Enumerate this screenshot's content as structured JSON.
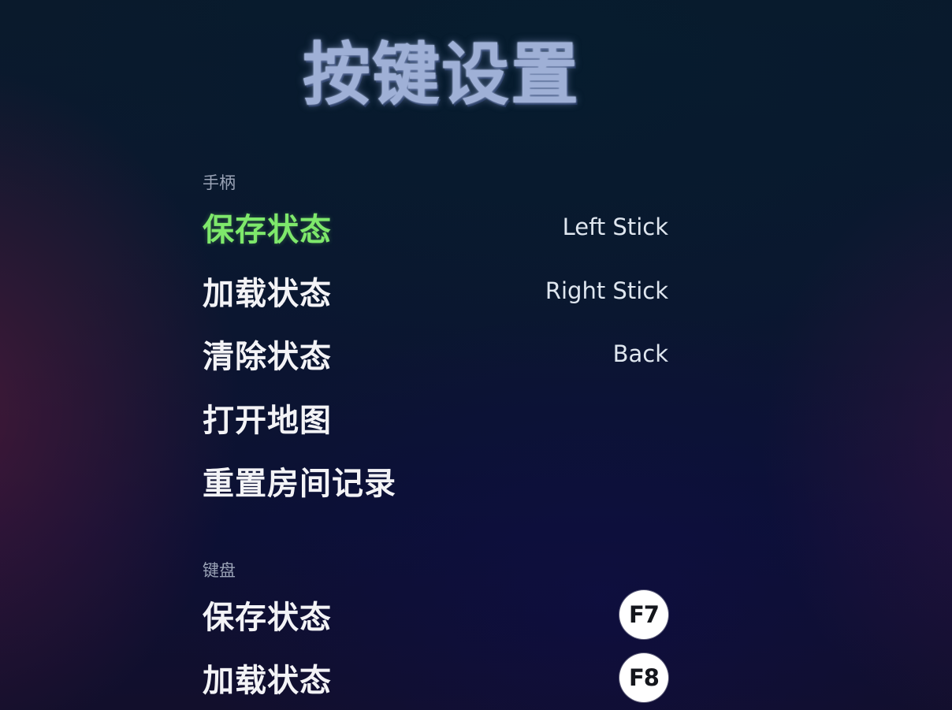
{
  "page": {
    "title": "按键设置"
  },
  "gamepad": {
    "label": "手柄",
    "bindings": [
      {
        "action": "保存状态",
        "binding": "Left Stick",
        "selected": true
      },
      {
        "action": "加载状态",
        "binding": "Right Stick"
      },
      {
        "action": "清除状态",
        "binding": "Back"
      },
      {
        "action": "打开地图",
        "binding": ""
      },
      {
        "action": "重置房间记录",
        "binding": ""
      }
    ]
  },
  "keyboard": {
    "label": "键盘",
    "bindings": [
      {
        "action": "保存状态",
        "key": "F7"
      },
      {
        "action": "加载状态",
        "key": "F8"
      }
    ]
  },
  "colors": {
    "selected": "#7ee86b",
    "title": "#9fb0d6",
    "text": "#f3f3f6",
    "section_label": "#9aa3b6",
    "key_badge_bg": "#ffffff"
  }
}
